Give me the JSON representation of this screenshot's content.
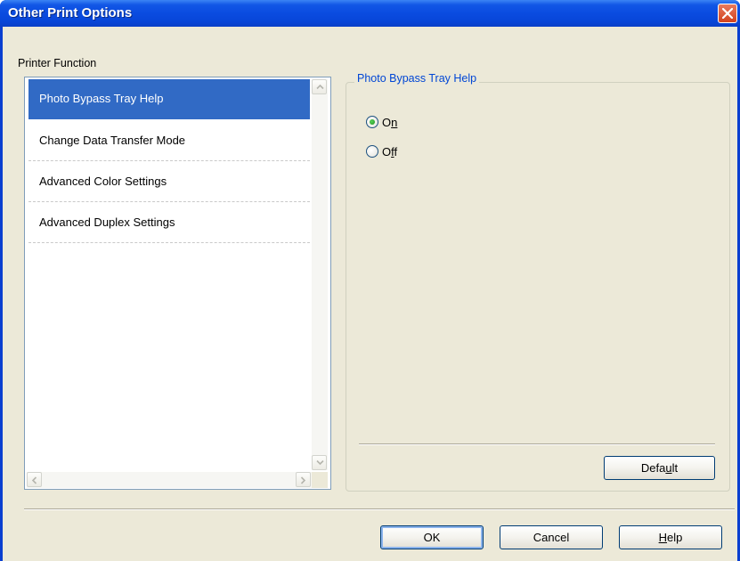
{
  "window": {
    "title": "Other Print Options"
  },
  "printer_function": {
    "group_label": "Printer Function",
    "items": [
      {
        "label": "Photo Bypass Tray Help",
        "selected": true
      },
      {
        "label": "Change Data Transfer Mode",
        "selected": false
      },
      {
        "label": "Advanced Color Settings",
        "selected": false
      },
      {
        "label": "Advanced Duplex Settings",
        "selected": false
      }
    ]
  },
  "settings_panel": {
    "title": "Photo Bypass Tray Help",
    "options": [
      {
        "label_pre": "O",
        "label_ul": "n",
        "label_post": "",
        "checked": true
      },
      {
        "label_pre": "O",
        "label_ul": "f",
        "label_post": "f",
        "checked": false
      }
    ],
    "default_button": {
      "pre": "Defa",
      "ul": "u",
      "post": "lt"
    }
  },
  "footer": {
    "ok_label": "OK",
    "cancel_label": "Cancel",
    "help_button": {
      "pre": "",
      "ul": "H",
      "post": "elp"
    }
  },
  "colors": {
    "title_bar": "#0a4be0",
    "selection": "#316ac5",
    "legend_text": "#0046d5",
    "dialog_face": "#ece9d8",
    "radio_dot": "#1b8f1b",
    "close_button": "#d2421e"
  }
}
